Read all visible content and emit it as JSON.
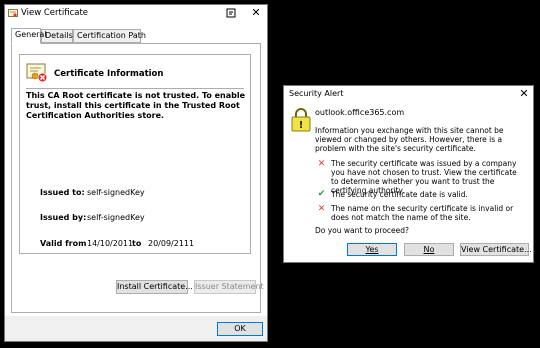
{
  "cert_window": {
    "title": "View Certificate",
    "tabs": [
      "General",
      "Details",
      "Certification Path"
    ],
    "info_title": "Certificate Information",
    "warning": "This CA Root certificate is not trusted. To enable trust, install this certificate in the Trusted Root Certification Authorities store.",
    "issued_to_label": "Issued to:",
    "issued_to_value": "self-signedKey",
    "issued_by_label": "Issued by:",
    "issued_by_value": "self-signedKey",
    "valid_from_label": "Valid from",
    "valid_from_value": "14/10/2011",
    "valid_to_label": "to",
    "valid_to_value": "20/09/2111",
    "install_button": "Install Certificate...",
    "issuer_statement_button": "Issuer Statement",
    "ok_button": "OK"
  },
  "alert_window": {
    "title": "Security Alert",
    "site": "outlook.office365.com",
    "intro": "Information you exchange with this site cannot be viewed or changed by others. However, there is a problem with the site's security certificate.",
    "items": [
      {
        "status": "error",
        "icon": "red-x-icon",
        "text": "The security certificate was issued by a company you have not chosen to trust. View the certificate to determine whether you want to trust the certifying authority."
      },
      {
        "status": "ok",
        "icon": "green-check-icon",
        "text": "The security certificate date is valid."
      },
      {
        "status": "error",
        "icon": "red-x-icon",
        "text": "The name on the security certificate is invalid or does not match the name of the site."
      }
    ],
    "prompt": "Do you want to proceed?",
    "yes_button": "Yes",
    "no_button": "No",
    "view_button": "View Certificate..."
  },
  "colors": {
    "error": "#d9412b",
    "ok": "#2e9a3e",
    "focus": "#0078d7"
  }
}
